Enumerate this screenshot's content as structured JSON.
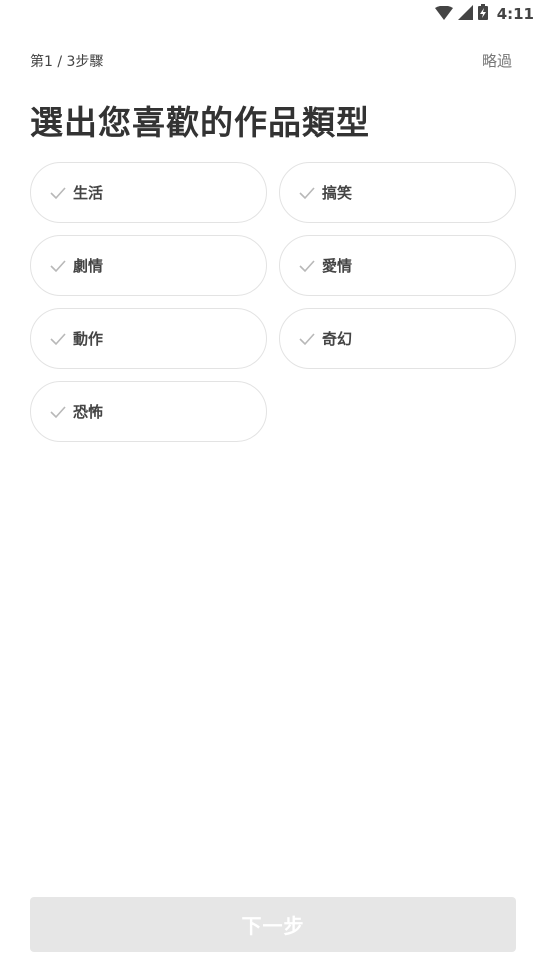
{
  "status_bar": {
    "time": "4:11",
    "icons": [
      "wifi-icon",
      "signal-icon",
      "battery-charging-icon"
    ]
  },
  "header": {
    "step_label": "第1 / 3步驟",
    "skip_label": "略過"
  },
  "main": {
    "title": "選出您喜歡的作品類型",
    "genres": [
      {
        "label": "生活",
        "icon": "check-icon",
        "selected": false
      },
      {
        "label": "搞笑",
        "icon": "check-icon",
        "selected": false
      },
      {
        "label": "劇情",
        "icon": "check-icon",
        "selected": false
      },
      {
        "label": "愛情",
        "icon": "check-icon",
        "selected": false
      },
      {
        "label": "動作",
        "icon": "check-icon",
        "selected": false
      },
      {
        "label": "奇幻",
        "icon": "check-icon",
        "selected": false
      },
      {
        "label": "恐怖",
        "icon": "check-icon",
        "selected": false
      }
    ]
  },
  "footer": {
    "next_label": "下一步",
    "next_enabled": false
  },
  "colors": {
    "text_primary": "#333333",
    "text_secondary": "#777777",
    "chip_border": "#e3e3e3",
    "check_gray": "#b8b8b8",
    "button_disabled_bg": "#e6e6e6",
    "button_text": "#ffffff"
  }
}
